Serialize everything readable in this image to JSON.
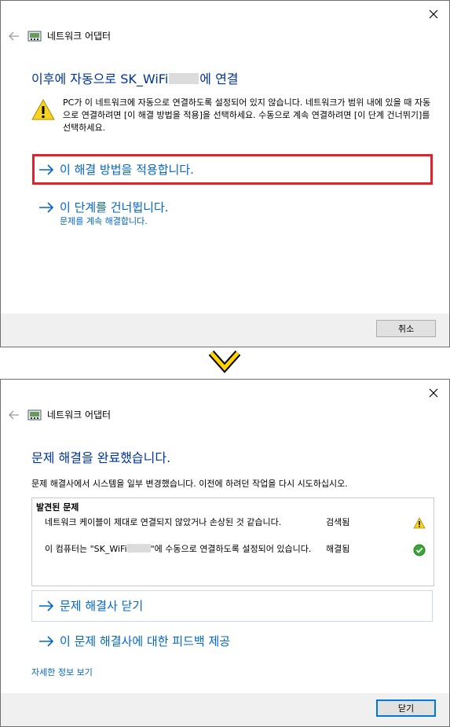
{
  "colors": {
    "link": "#0066cc",
    "heading": "#003399",
    "highlight": "#e3212b",
    "chevron": "#ffd200"
  },
  "dialog1": {
    "header_title": "네트워크 어댑터",
    "heading_prefix": "이후에 자동으로 SK_WiFi",
    "heading_suffix": "에 연결",
    "warning_text": "PC가 이 네트워크에 자동으로 연결하도록 설정되어 있지 않습니다. 네트워크가 범위 내에 있을 때 자동으로 연결하려면 [이 해결 방법을 적용]을 선택하세요. 수동으로 계속 연결하려면 [이 단계 건너뛰기]를 선택하세요.",
    "apply_fix": "이 해결 방법을 적용합니다.",
    "skip_step": "이 단계를 건너뜁니다.",
    "skip_sub": "문제를 계속 해결합니다.",
    "cancel_label": "취소"
  },
  "dialog2": {
    "header_title": "네트워크 어댑터",
    "heading": "문제 해결을 완료했습니다.",
    "description": "문제 해결사에서 시스템을 일부 변경했습니다. 이전에 하려던 작업을 다시 시도하십시오.",
    "problems_title": "발견된 문제",
    "problems": [
      {
        "text": "네트워크 케이블이 제대로 연결되지 않았거나 손상된 것 같습니다.",
        "status": "검색됨",
        "icon": "warning-icon"
      },
      {
        "text_prefix": "이 컴퓨터는 \"SK_WiFi",
        "text_suffix": "\"에 수동으로 연결하도록 설정되어 있습니다.",
        "status": "해결됨",
        "icon": "check-icon"
      }
    ],
    "close_troubleshooter": "문제 해결사 닫기",
    "feedback": "이 문제 해결사에 대한 피드백 제공",
    "details_link": "자세한 정보 보기",
    "close_label": "닫기"
  }
}
